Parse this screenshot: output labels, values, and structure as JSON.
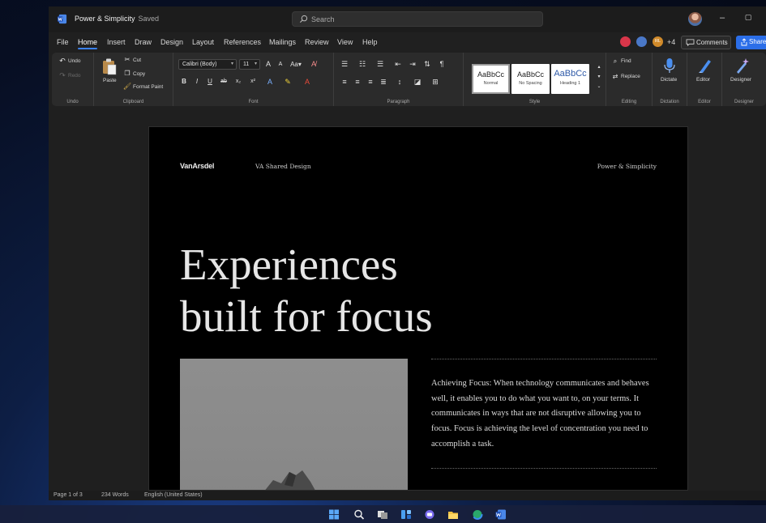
{
  "titlebar": {
    "doc_title": "Power & Simplicity",
    "save_status": "Saved",
    "search_placeholder": "Search",
    "icons": [
      "word-app-icon",
      "search-icon",
      "user-avatar",
      "minimize-icon",
      "maximize-icon"
    ]
  },
  "menu": [
    {
      "label": "File",
      "active": false
    },
    {
      "label": "Home",
      "active": true
    },
    {
      "label": "Insert",
      "active": false
    },
    {
      "label": "Draw",
      "active": false
    },
    {
      "label": "Design",
      "active": false
    },
    {
      "label": "Layout",
      "active": false
    },
    {
      "label": "References",
      "active": false
    },
    {
      "label": "Mailings",
      "active": false
    },
    {
      "label": "Review",
      "active": false
    },
    {
      "label": "View",
      "active": false
    },
    {
      "label": "Help",
      "active": false
    }
  ],
  "collaboration": {
    "collaborator_colors": [
      "#d9364a",
      "#4a78c8",
      "#d08a2a"
    ],
    "collaborator_initials": [
      "",
      "",
      "RL"
    ],
    "extra_count": "+4",
    "comments_label": "Comments",
    "share_label": "Share"
  },
  "ribbon": {
    "undo": {
      "undo_label": "Undo",
      "redo_label": "Redo",
      "group": "Undo"
    },
    "clipboard": {
      "paste_label": "Paste",
      "cut_label": "Cut",
      "copy_label": "Copy",
      "format_painter_label": "Format Paint",
      "group": "Clipboard"
    },
    "font": {
      "font_name": "Calibri (Body)",
      "font_size": "11",
      "group": "Font",
      "bold": "B",
      "italic": "I",
      "underline": "U",
      "strike": "ab",
      "subscript": "x₂",
      "superscript": "x²"
    },
    "paragraph": {
      "group": "Paragraph"
    },
    "styles": {
      "items": [
        {
          "preview": "AaBbCc",
          "name": "Normal",
          "selected": true
        },
        {
          "preview": "AaBbCc",
          "name": "No Spacing",
          "selected": false
        },
        {
          "preview": "AaBbCc",
          "name": "Heading 1",
          "selected": false
        }
      ],
      "group": "Style"
    },
    "editing": {
      "find_label": "Find",
      "replace_label": "Replace",
      "group": "Editing"
    },
    "dictation": {
      "label": "Dictate",
      "group": "Dictation"
    },
    "editor": {
      "label": "Editor",
      "group": "Editor"
    },
    "designer": {
      "label": "Designer",
      "group": "Designer"
    }
  },
  "document": {
    "brand": "VanArsdel",
    "header_center": "VA Shared Design",
    "header_right": "Power & Simplicity",
    "headline_line1": "Experiences",
    "headline_line2": "built for focus",
    "body": "Achieving Focus: When technology communicates and behaves well, it enables you to do what you want to, on your terms. It communicates in ways that are not disruptive allowing you to focus. Focus is achieving the level of concentration you need to accomplish a task."
  },
  "statusbar": {
    "page": "Page 1 of 3",
    "words": "234 Words",
    "language": "English (United States)"
  },
  "taskbar": {
    "icons": [
      "windows-start-icon",
      "taskbar-search-icon",
      "task-view-icon",
      "widgets-icon",
      "teams-chat-icon",
      "file-explorer-icon",
      "edge-browser-icon",
      "word-taskbar-icon"
    ]
  },
  "colors": {
    "accent": "#3b82f6",
    "share_button": "#2b6ee8",
    "ribbon_bg": "#2b2b2b",
    "page_bg": "#000000"
  }
}
